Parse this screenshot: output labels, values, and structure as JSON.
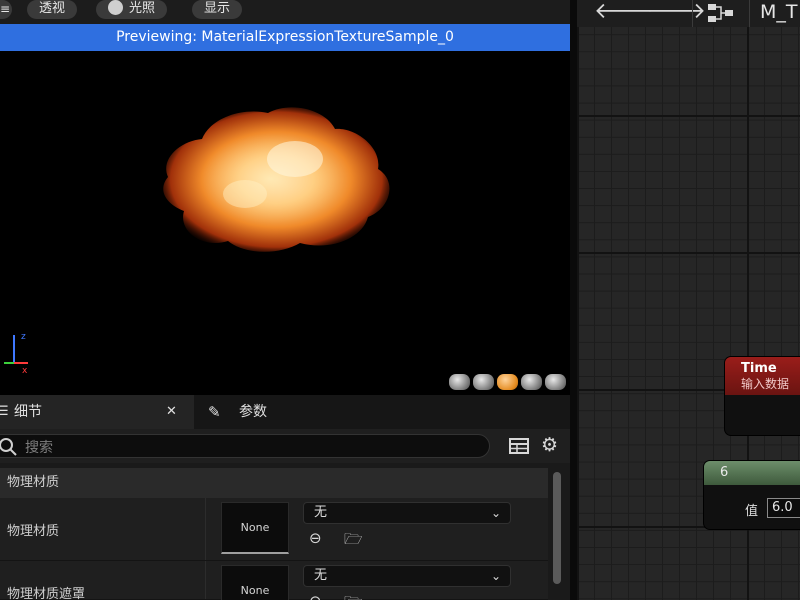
{
  "viewport_toolbar": {
    "perspective_label": "透视",
    "lit_label": "光照",
    "show_label": "显示"
  },
  "preview": {
    "banner": "Previewing: MaterialExpressionTextureSample_0"
  },
  "preview_shapes": [
    "cylinder",
    "sphere",
    "plane",
    "cube",
    "custom-mesh"
  ],
  "details": {
    "tabs": [
      {
        "label": "细节",
        "closable": true
      },
      {
        "label": "参数"
      }
    ],
    "search_placeholder": "搜索",
    "section_title": "物理材质",
    "rows": [
      {
        "label": "物理材质",
        "thumb": "None",
        "combo": "无"
      },
      {
        "label": "物理材质遮罩",
        "thumb": "None",
        "combo": "无"
      }
    ]
  },
  "graph": {
    "title": "M_T",
    "nodes": {
      "time": {
        "title": "Time",
        "subtitle": "输入数据"
      },
      "constant": {
        "title": "6",
        "value_label": "值",
        "value": "6.0"
      }
    }
  },
  "colors": {
    "preview_banner": "#2f6fe0",
    "time_node_header": "#9a1d1a",
    "constant_node_header": "#6d8e6b",
    "selected_shape": "#e48a1e"
  }
}
